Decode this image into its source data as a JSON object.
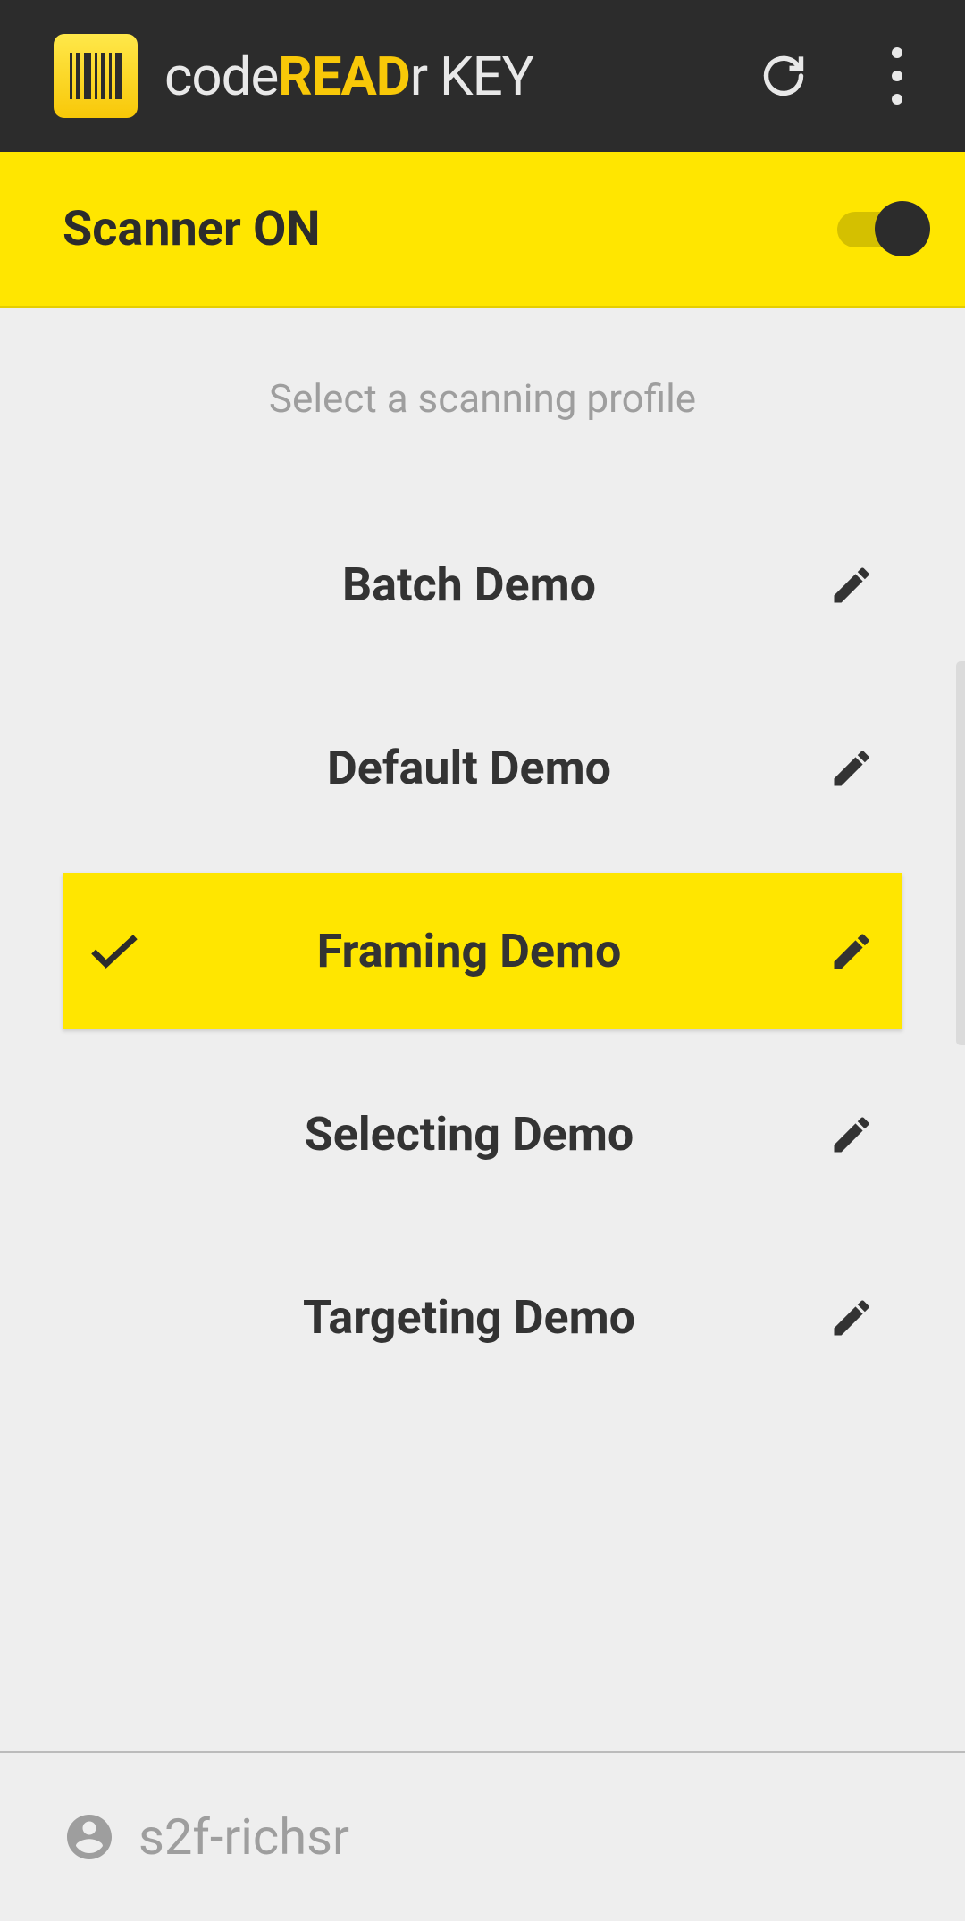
{
  "header": {
    "title_part1": "code",
    "title_part2": "READ",
    "title_part3": "r",
    "title_part4": " KEY"
  },
  "scanner": {
    "label": "Scanner ON",
    "enabled": true
  },
  "subtitle": "Select a scanning profile",
  "profiles": [
    {
      "name": "Batch Demo",
      "selected": false
    },
    {
      "name": "Default Demo",
      "selected": false
    },
    {
      "name": "Framing Demo",
      "selected": true
    },
    {
      "name": "Selecting Demo",
      "selected": false
    },
    {
      "name": "Targeting Demo",
      "selected": false
    }
  ],
  "footer": {
    "username": "s2f-richsr"
  }
}
